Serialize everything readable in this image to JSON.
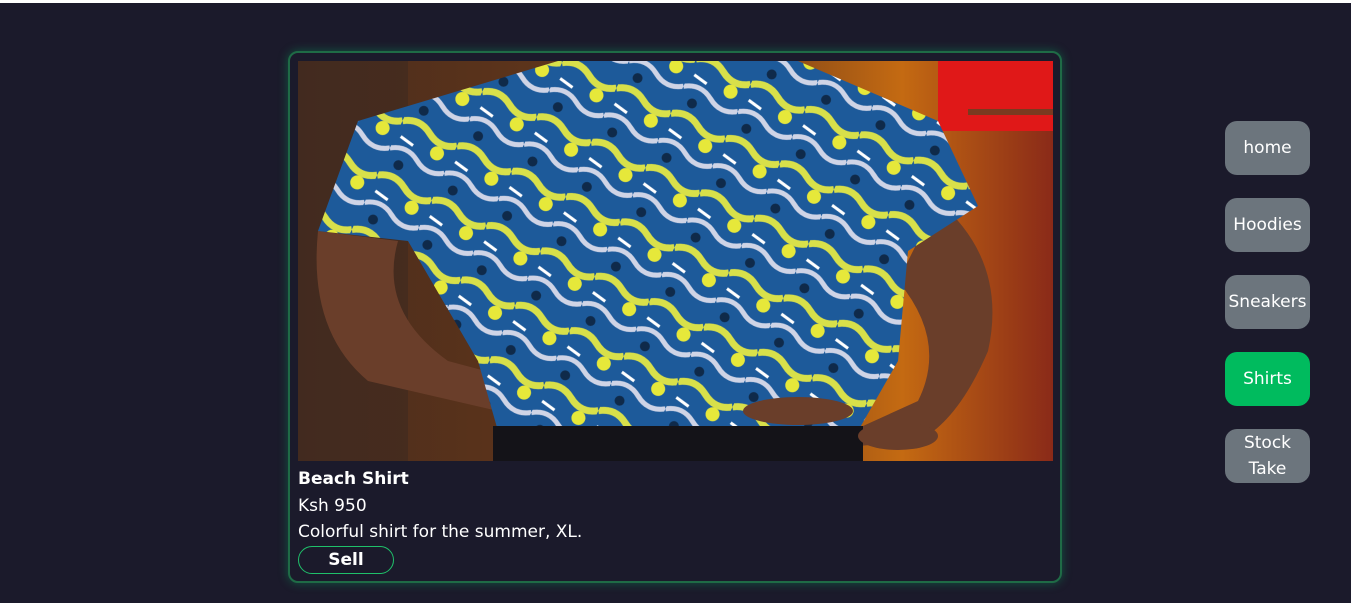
{
  "product": {
    "title": "Beach Shirt",
    "price": "Ksh 950",
    "description": "Colorful shirt for the summer, XL.",
    "sell_label": "Sell"
  },
  "nav": {
    "items": [
      {
        "label": "home",
        "active": false
      },
      {
        "label": "Hoodies",
        "active": false
      },
      {
        "label": "Sneakers",
        "active": false
      },
      {
        "label": "Shirts",
        "active": true
      },
      {
        "label": "Stock Take",
        "active": false
      }
    ]
  },
  "colors": {
    "background": "#1b1a2b",
    "card_border": "#1f6b46",
    "active_nav": "#00bb5e",
    "inactive_nav": "#6c757d"
  }
}
